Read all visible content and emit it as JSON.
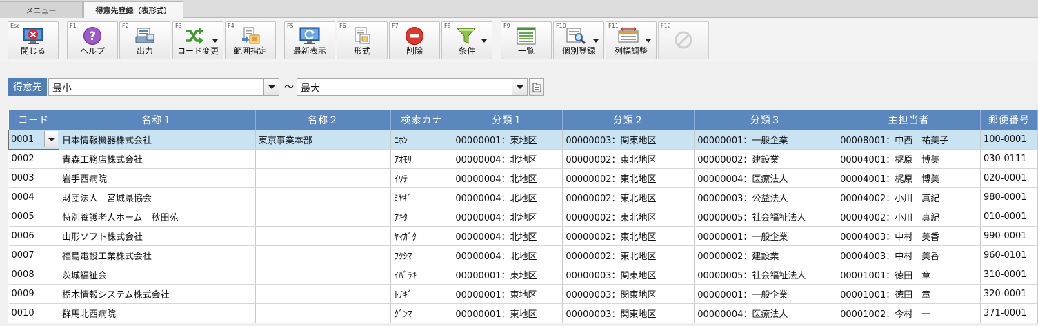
{
  "tabs": [
    {
      "label": "メニュー"
    },
    {
      "label": "得意先登録（表形式）"
    }
  ],
  "toolbar": [
    {
      "key": "Esc",
      "label": "閉じる",
      "icon": "close-icon"
    },
    {
      "key": "F1",
      "label": "ヘルプ",
      "icon": "help-icon"
    },
    {
      "key": "F2",
      "label": "出力",
      "icon": "print-icon"
    },
    {
      "key": "F3",
      "label": "コード変更",
      "icon": "shuffle-icon"
    },
    {
      "key": "F4",
      "label": "範囲指定",
      "icon": "range-icon"
    },
    {
      "key": "F5",
      "label": "最新表示",
      "icon": "refresh-icon"
    },
    {
      "key": "F6",
      "label": "形式",
      "icon": "format-icon"
    },
    {
      "key": "F7",
      "label": "削除",
      "icon": "delete-icon"
    },
    {
      "key": "F8",
      "label": "条件",
      "icon": "filter-icon"
    },
    {
      "key": "F9",
      "label": "一覧",
      "icon": "list-icon"
    },
    {
      "key": "F10",
      "label": "個別登録",
      "icon": "individual-register-icon"
    },
    {
      "key": "F11",
      "label": "列幅調整",
      "icon": "column-width-icon"
    },
    {
      "key": "F12",
      "label": "",
      "icon": "disabled-icon"
    }
  ],
  "filter": {
    "label": "得意先",
    "from_value": "最小",
    "separator": "～",
    "to_value": "最大"
  },
  "grid": {
    "headers": [
      "コード",
      "名称１",
      "名称２",
      "検索カナ",
      "分類１",
      "分類２",
      "分類３",
      "主担当者",
      "郵便番号"
    ],
    "rows": [
      [
        "0001",
        "日本情報機器株式会社",
        "東京事業本部",
        "ﾆﾎﾝ",
        "00000001：東地区",
        "00000003：関東地区",
        "00000001：一般企業",
        "00008001：中西　祐美子",
        "100-0001"
      ],
      [
        "0002",
        "青森工務店株式会社",
        "",
        "ｱｵﾓﾘ",
        "00000004：北地区",
        "00000002：東北地区",
        "00000002：建設業",
        "00004001：梶原　博美",
        "030-0111"
      ],
      [
        "0003",
        "岩手西病院",
        "",
        "ｲﾜﾃ",
        "00000004：北地区",
        "00000002：東北地区",
        "00000004：医療法人",
        "00004001：梶原　博美",
        "020-0001"
      ],
      [
        "0004",
        "財団法人　宮城県協会",
        "",
        "ﾐﾔｷﾞ",
        "00000004：北地区",
        "00000002：東北地区",
        "00000003：公益法人",
        "00004002：小川　真紀",
        "980-0001"
      ],
      [
        "0005",
        "特別養護老人ホーム　秋田苑",
        "",
        "ｱｷﾀ",
        "00000004：北地区",
        "00000002：東北地区",
        "00000005：社会福祉法人",
        "00004002：小川　真紀",
        "010-0001"
      ],
      [
        "0006",
        "山形ソフト株式会社",
        "",
        "ﾔﾏｶﾞﾀ",
        "00000004：北地区",
        "00000002：東北地区",
        "00000001：一般企業",
        "00004003：中村　美香",
        "990-0001"
      ],
      [
        "0007",
        "福島電設工業株式会社",
        "",
        "ﾌｸｼﾏ",
        "00000004：北地区",
        "00000002：東北地区",
        "00000002：建設業",
        "00004003：中村　美香",
        "960-0101"
      ],
      [
        "0008",
        "茨城福祉会",
        "",
        "ｲﾊﾞﾗｷ",
        "00000001：東地区",
        "00000003：関東地区",
        "00000005：社会福祉法人",
        "00001001：徳田　章",
        "310-0001"
      ],
      [
        "0009",
        "栃木情報システム株式会社",
        "",
        "ﾄﾁｷﾞ",
        "00000001：東地区",
        "00000003：関東地区",
        "00000001：一般企業",
        "00001001：徳田　章",
        "320-0001"
      ],
      [
        "0010",
        "群馬北西病院",
        "",
        "ｸﾞﾝﾏ",
        "00000001：東地区",
        "00000003：関東地区",
        "00000004：医療法人",
        "00001002：今村　一",
        "371-0001"
      ]
    ]
  }
}
